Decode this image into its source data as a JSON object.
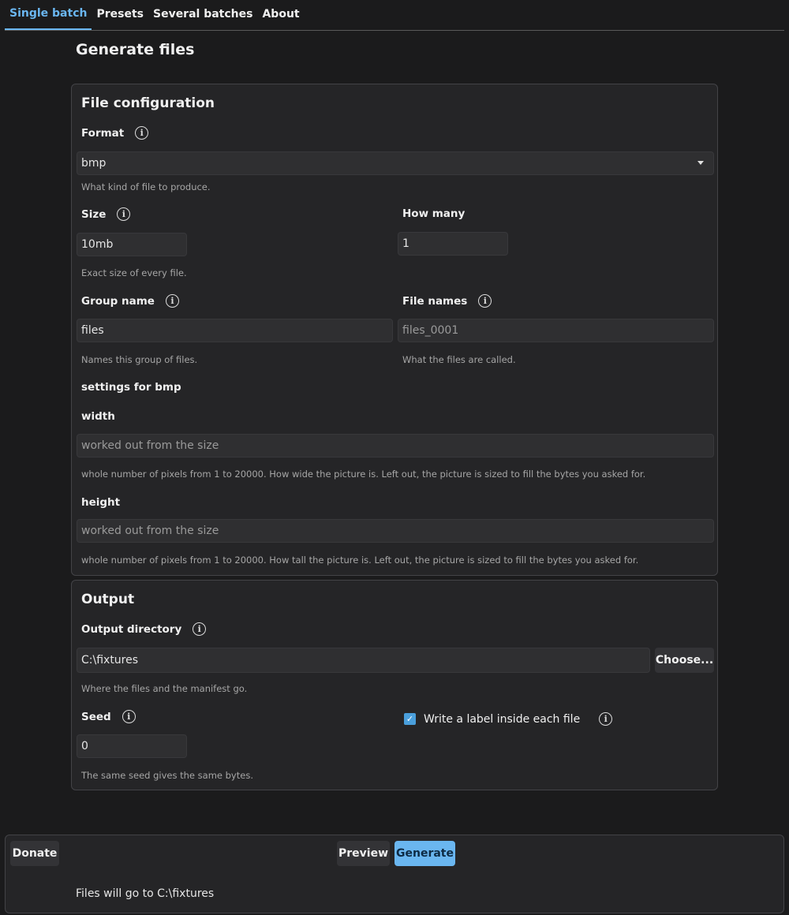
{
  "tabs": [
    {
      "label": "Single batch",
      "active": true
    },
    {
      "label": "Presets"
    },
    {
      "label": "Several batches"
    },
    {
      "label": "About"
    }
  ],
  "page_title": "Generate files",
  "file_config": {
    "title": "File configuration",
    "format": {
      "label": "Format",
      "value": "bmp",
      "hint": "What kind of file to produce."
    },
    "size": {
      "label": "Size",
      "value": "10mb",
      "hint": "Exact size of every file."
    },
    "how_many": {
      "label": "How many",
      "value": "1"
    },
    "group_name": {
      "label": "Group name",
      "value": "files",
      "hint": "Names this group of files."
    },
    "file_names": {
      "label": "File names",
      "placeholder": "files_0001",
      "hint": "What the files are called."
    },
    "settings_heading": "settings for bmp",
    "width": {
      "label": "width",
      "placeholder": "worked out from the size",
      "hint": "whole number of pixels from 1 to 20000. How wide the picture is. Left out, the picture is sized to fill the bytes you asked for."
    },
    "height": {
      "label": "height",
      "placeholder": "worked out from the size",
      "hint": "whole number of pixels from 1 to 20000. How tall the picture is. Left out, the picture is sized to fill the bytes you asked for."
    }
  },
  "output": {
    "title": "Output",
    "directory": {
      "label": "Output directory",
      "value": "C:\\fixtures",
      "hint": "Where the files and the manifest go.",
      "choose_label": "Choose..."
    },
    "seed": {
      "label": "Seed",
      "value": "0",
      "hint": "The same seed gives the same bytes."
    },
    "label_checkbox": {
      "label": "Write a label inside each file",
      "checked": true
    }
  },
  "footer": {
    "donate_label": "Donate",
    "preview_label": "Preview",
    "generate_label": "Generate",
    "status": "Files will go to C:\\fixtures"
  },
  "icons": {
    "info": "info-icon",
    "dropdown": "chevron-down-icon",
    "check": "check-icon"
  },
  "colors": {
    "accent": "#6ab6f0",
    "background": "#1b1b1c",
    "panel": "#252527"
  }
}
